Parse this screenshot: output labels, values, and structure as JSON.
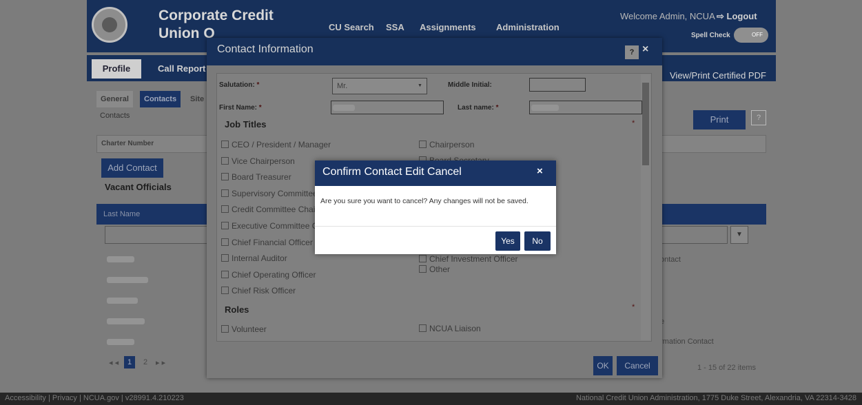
{
  "app": {
    "title_line1": "Corporate Credit",
    "title_line2": "Union O",
    "nav": [
      "CU Search",
      "SSA",
      "Assignments",
      "Administration"
    ],
    "welcome": "Welcome Admin, NCUA",
    "logout": "Logout",
    "spell_check_label": "Spell Check",
    "spell_check_state": "OFF",
    "main_tabs": [
      "Profile",
      "Call Report"
    ],
    "view_pdf": "View/Print Certified PDF",
    "sub_tabs": [
      "General",
      "Contacts",
      "Site"
    ],
    "breadcrumb": "Contacts",
    "charter_label": "Charter Number",
    "add_contact": "Add Contact",
    "print": "Print",
    "help": "?",
    "vacant_officials": "Vacant Officials",
    "grid_col_last_name": "Last Name",
    "grid_side_rows": [
      "ontact",
      "e",
      "rmation Contact"
    ],
    "pager_pages": [
      "1",
      "2"
    ],
    "pager_info": "1 - 15 of 22 items",
    "footer_left": "Accessibility | Privacy | NCUA.gov | v28991.4.210223",
    "footer_right": "National Credit Union Administration, 1775 Duke Street, Alexandria, VA 22314-3428"
  },
  "contact_modal": {
    "title": "Contact Information",
    "help": "?",
    "close": "×",
    "salutation_label": "Salutation:",
    "salutation_value": "Mr.",
    "middle_initial_label": "Middle Initial:",
    "first_name_label": "First Name:",
    "last_name_label": "Last name:",
    "required_mark": "*",
    "job_titles_heading": "Job Titles",
    "job_titles_left": [
      "CEO / President / Manager",
      "Vice Chairperson",
      "Board Treasurer",
      "Supervisory Committee",
      "Credit Committee Chair",
      "Executive Committee C",
      "Chief Financial Officer",
      "Internal Auditor",
      "Chief Operating Officer",
      "Chief Risk Officer"
    ],
    "job_titles_right": [
      "Chairperson",
      "Board Secretary",
      "Chief Investment Officer",
      "Other"
    ],
    "roles_heading": "Roles",
    "roles": [
      "Volunteer",
      "NCUA Liaison"
    ],
    "ok": "OK",
    "cancel": "Cancel"
  },
  "confirm_dialog": {
    "title": "Confirm Contact Edit Cancel",
    "close": "×",
    "message": "Are you sure you want to cancel? Any changes will not be saved.",
    "yes": "Yes",
    "no": "No"
  }
}
